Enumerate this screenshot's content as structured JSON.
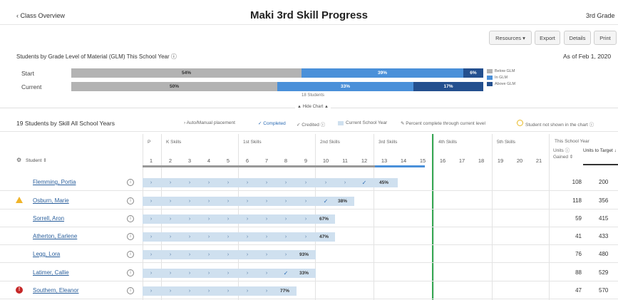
{
  "header": {
    "back_label": "‹ Class Overview",
    "title": "Maki 3rd Skill Progress",
    "grade": "3rd Grade"
  },
  "toolbar": {
    "resources": "Resources ▾",
    "export": "Export",
    "details": "Details",
    "print": "Print"
  },
  "glm": {
    "title": "Students by Grade Level of Material (GLM) This School Year ⓘ",
    "as_of": "As of Feb 1, 2020",
    "start_label": "Start",
    "current_label": "Current",
    "start": {
      "below": "54%",
      "in": "39%",
      "above": "6%"
    },
    "current": {
      "below": "50%",
      "in": "33%",
      "above": "17%"
    },
    "legend": [
      "Below GLM",
      "In GLM",
      "Above GLM"
    ],
    "students_count": "18 Students",
    "hide_chart": "▲ Hide Chart ▲",
    "colors": {
      "below": "#b3b3b3",
      "in": "#4a90d9",
      "above": "#24508f"
    }
  },
  "skills": {
    "title": "19 Students by Skill All School Years",
    "legend": {
      "auto": "› Auto/Manual placement",
      "completed": "✓ Completed",
      "credited": "✓ Credited ⓘ",
      "current_year": "Current School Year",
      "percent": "✎ Percent complete through current level",
      "not_shown": "Student not shown in the chart ⓘ"
    },
    "groups": [
      "P",
      "K Skills",
      "1st Skills",
      "2nd Skills",
      "3rd Skills",
      "4th Skills",
      "5th Skills"
    ],
    "numbers": [
      "1",
      "2",
      "3",
      "4",
      "5",
      "6",
      "7",
      "8",
      "9",
      "10",
      "11",
      "12",
      "13",
      "14",
      "15",
      "16",
      "17",
      "18",
      "19",
      "20",
      "21"
    ],
    "student_header": "Student ⇕",
    "this_year": "This School Year",
    "units_gained": "Units ⓘ Gained ⇕",
    "units_target": "Units to Target ↓",
    "students": [
      {
        "name": "Flemming, Portia",
        "gained": "108",
        "target": "200",
        "pct": "45%"
      },
      {
        "name": "Osburn, Marie",
        "gained": "118",
        "target": "356",
        "pct": "38%"
      },
      {
        "name": "Sorrell, Aron",
        "gained": "59",
        "target": "415",
        "pct": "67%"
      },
      {
        "name": "Atherton, Earlene",
        "gained": "41",
        "target": "433",
        "pct": "47%"
      },
      {
        "name": "Legg, Lora",
        "gained": "76",
        "target": "480",
        "pct": "93%"
      },
      {
        "name": "Latimer, Callie",
        "gained": "88",
        "target": "529",
        "pct": "33%"
      },
      {
        "name": "Southern, Eleanor",
        "gained": "47",
        "target": "570",
        "pct": "77%"
      }
    ]
  }
}
